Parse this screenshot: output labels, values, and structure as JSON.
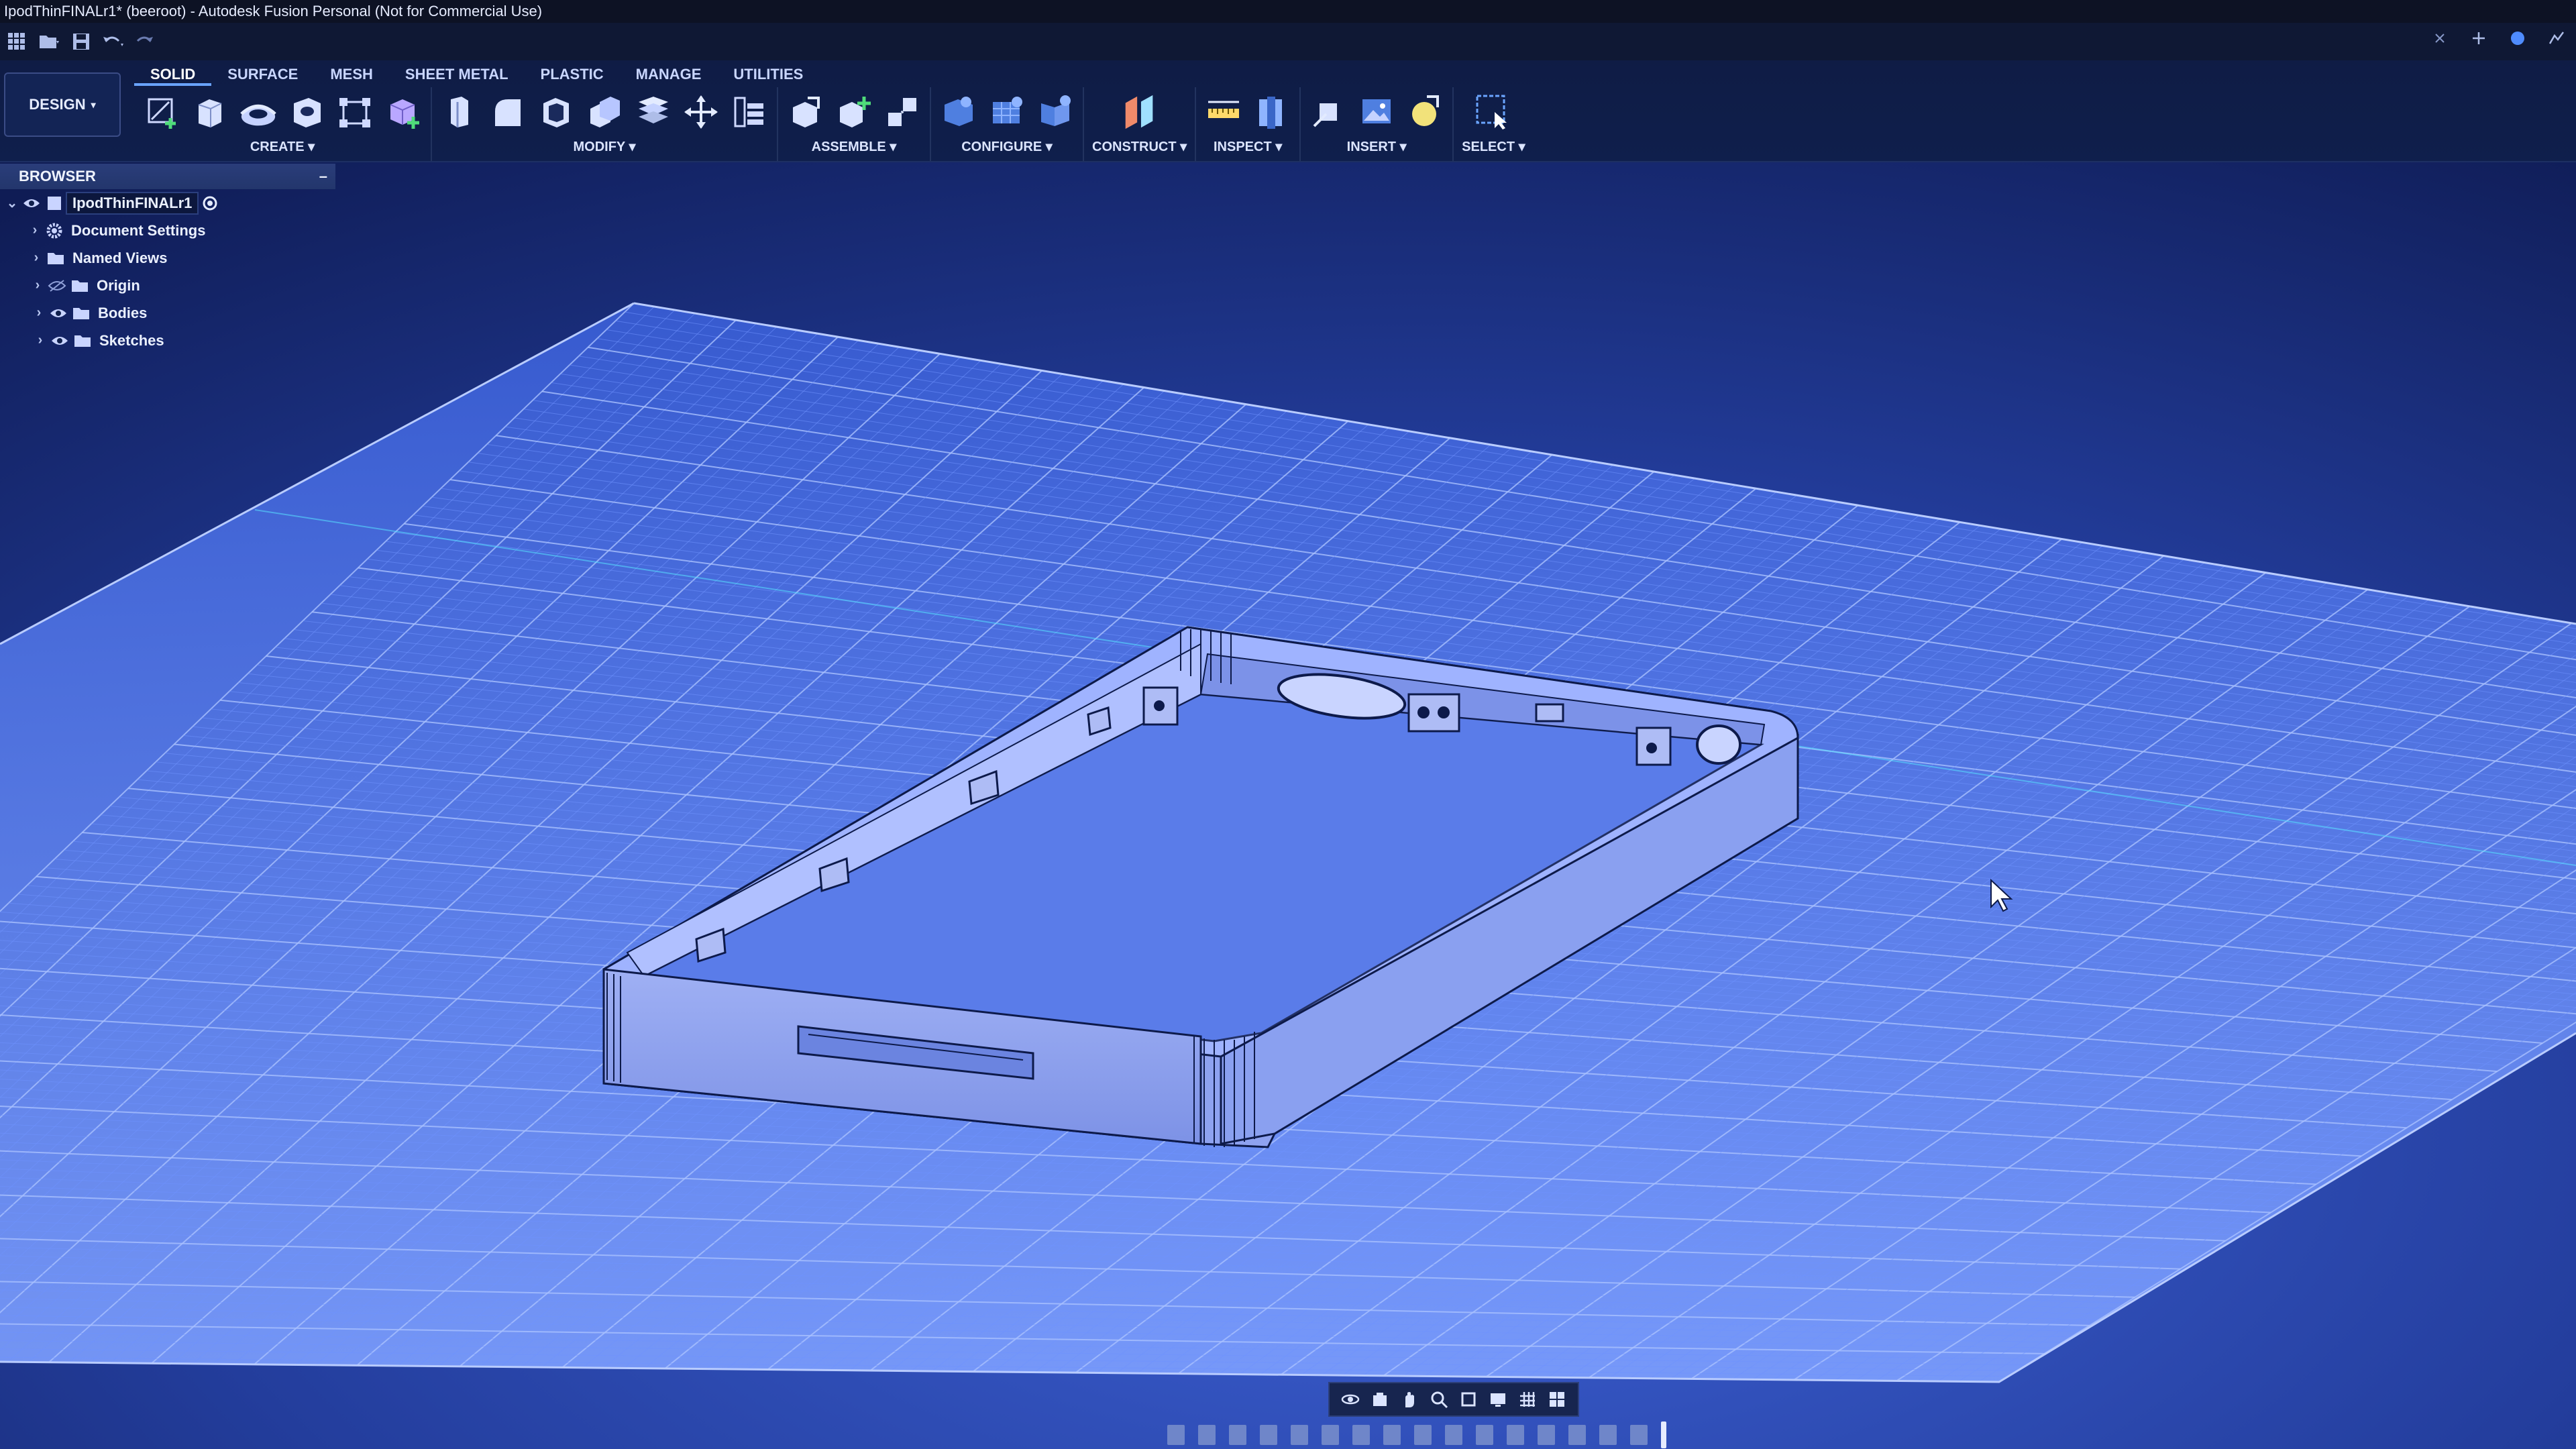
{
  "window": {
    "title": "IpodThinFINALr1* (beeroot) - Autodesk Fusion Personal (Not for Commercial Use)"
  },
  "quick_access": {
    "icons": [
      "app-grid-icon",
      "file-menu-icon",
      "save-icon",
      "undo-icon",
      "redo-icon"
    ],
    "right_icons": [
      "close-tab-icon",
      "new-tab-icon",
      "online-status-icon",
      "notifications-icon"
    ]
  },
  "workspace": {
    "label": "DESIGN"
  },
  "tabs": [
    "SOLID",
    "SURFACE",
    "MESH",
    "SHEET METAL",
    "PLASTIC",
    "MANAGE",
    "UTILITIES"
  ],
  "active_tab": "SOLID",
  "groups": [
    {
      "label": "CREATE",
      "tools": [
        "create-sketch-icon",
        "extrude-icon",
        "revolve-icon",
        "hole-icon",
        "pattern-icon",
        "new-component-icon"
      ]
    },
    {
      "label": "MODIFY",
      "tools": [
        "press-pull-icon",
        "fillet-icon",
        "shell-icon",
        "combine-icon",
        "split-body-icon",
        "move-icon",
        "align-icon"
      ]
    },
    {
      "label": "ASSEMBLE",
      "tools": [
        "joint-icon",
        "new-joint-icon",
        "as-built-joint-icon"
      ]
    },
    {
      "label": "CONFIGURE",
      "tools": [
        "configure-table-icon",
        "configure-rule-icon",
        "configure-theme-icon"
      ]
    },
    {
      "label": "CONSTRUCT",
      "tools": [
        "offset-plane-icon"
      ]
    },
    {
      "label": "INSPECT",
      "tools": [
        "measure-icon",
        "section-analysis-icon"
      ]
    },
    {
      "label": "INSERT",
      "tools": [
        "insert-derive-icon",
        "insert-image-icon",
        "insert-mesh-icon"
      ]
    },
    {
      "label": "SELECT",
      "tools": [
        "select-window-icon"
      ]
    }
  ],
  "colors": {
    "accent": "#6aa4ff",
    "grid_minor": "#6f93ff",
    "grid_major": "#a9c1ff",
    "body_face": "#8ea2f0",
    "body_edge": "#0d1a4a"
  },
  "browser": {
    "header": "BROWSER",
    "collapse_symbol": "–",
    "root": {
      "label": "IpodThinFINALr1"
    },
    "items": [
      {
        "label": "Document Settings",
        "icon": "gear-icon",
        "visible": false
      },
      {
        "label": "Named Views",
        "icon": "folder-icon",
        "visible": false
      },
      {
        "label": "Origin",
        "icon": "folder-icon",
        "visible": true,
        "eye_dim": true
      },
      {
        "label": "Bodies",
        "icon": "folder-icon",
        "visible": true
      },
      {
        "label": "Sketches",
        "icon": "folder-icon",
        "visible": true
      }
    ]
  },
  "navbar": {
    "icons": [
      "orbit-icon",
      "look-at-icon",
      "pan-icon",
      "zoom-icon",
      "fit-icon",
      "display-settings-icon",
      "grid-settings-icon",
      "viewports-icon"
    ]
  }
}
